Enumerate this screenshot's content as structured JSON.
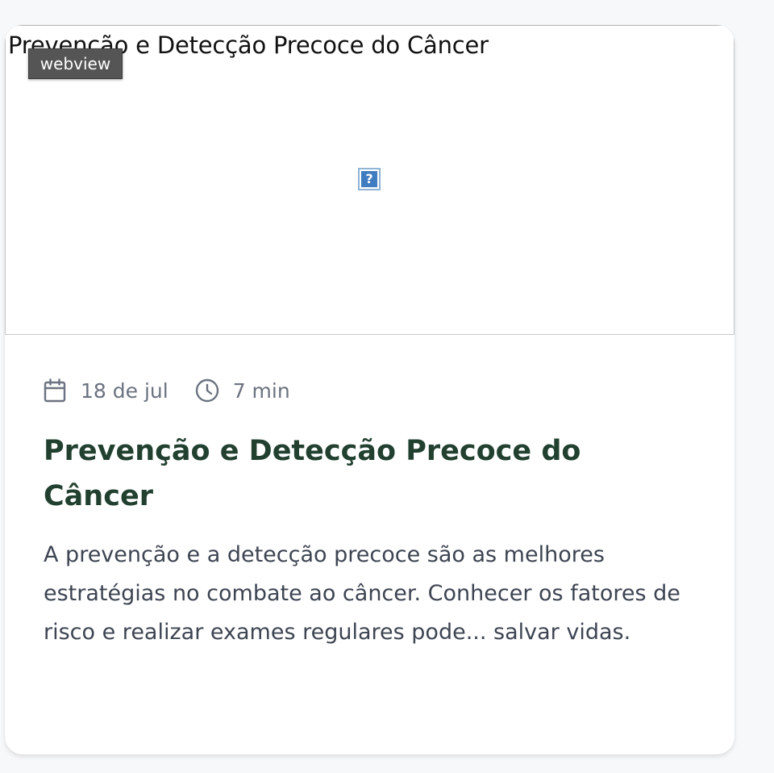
{
  "article": {
    "image_alt": "Prevenção e Detecção Precoce do Câncer",
    "broken_image_glyph": "?",
    "webview_label": "webview",
    "date": "18 de jul",
    "read_time": "7 min",
    "title": "Prevenção e Detecção Precoce do Câncer",
    "excerpt": "A prevenção e a detecção precoce são as melhores estratégias no combate ao câncer. Conhecer os fatores de risco e realizar exames regulares pode... salvar vidas.",
    "icons": {
      "date": "calendar-icon",
      "time": "clock-icon",
      "image": "broken-image-icon"
    }
  },
  "colors": {
    "title": "#21402f",
    "meta": "#6b7280",
    "excerpt": "#3d4452",
    "page_bg": "#f7f8fa",
    "card_bg": "#ffffff",
    "webview_tag_bg": "#555555"
  }
}
